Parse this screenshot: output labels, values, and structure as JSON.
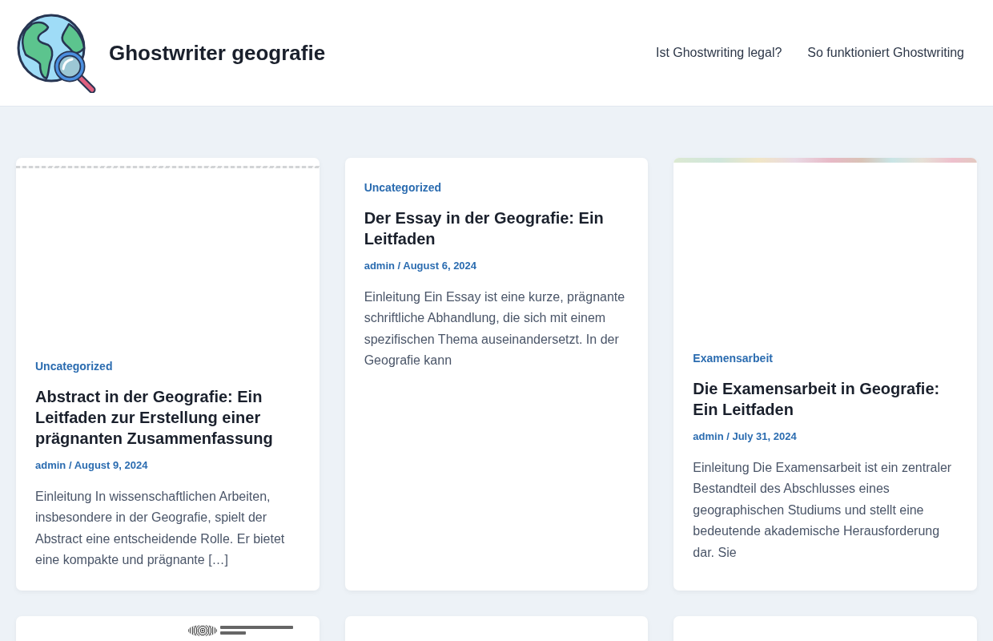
{
  "site": {
    "title": "Ghostwriter geografie"
  },
  "nav": [
    {
      "label": "Ist Ghostwriting legal?"
    },
    {
      "label": "So funktioniert Ghostwriting"
    }
  ],
  "posts": [
    {
      "kind": "faint-image",
      "category": "Uncategorized",
      "title": "Abstract in der Geografie: Ein Leitfaden zur Erstellung einer prägnanten Zusammenfassung",
      "meta": "admin / August 9, 2024",
      "excerpt": "Einleitung In wissenschaftlichen Arbeiten, insbesondere in der Geografie, spielt der Abstract eine entscheidende Rolle. Er bietet eine kompakte und prägnante […]"
    },
    {
      "kind": "text-only",
      "category": "Uncategorized",
      "title": "Der Essay in der Geografie: Ein Leitfaden",
      "meta": "admin / August 6, 2024",
      "excerpt": "Einleitung Ein Essay ist eine kurze, prägnante schriftliche Abhandlung, die sich mit einem spezifischen Thema auseinandersetzt. In der Geografie kann"
    },
    {
      "kind": "map-image",
      "category": "Examensarbeit",
      "title": "Die Examensarbeit in Geografie: Ein Leitfaden",
      "meta": "admin / July 31, 2024",
      "excerpt": "Einleitung Die Examensarbeit ist ein zentraler Bestandteil des Abschlusses eines geographischen Studiums und stellt eine bedeutende akademische Herausforderung dar. Sie"
    },
    {
      "kind": "logo-image"
    },
    {
      "kind": "plain"
    },
    {
      "kind": "plain"
    }
  ]
}
